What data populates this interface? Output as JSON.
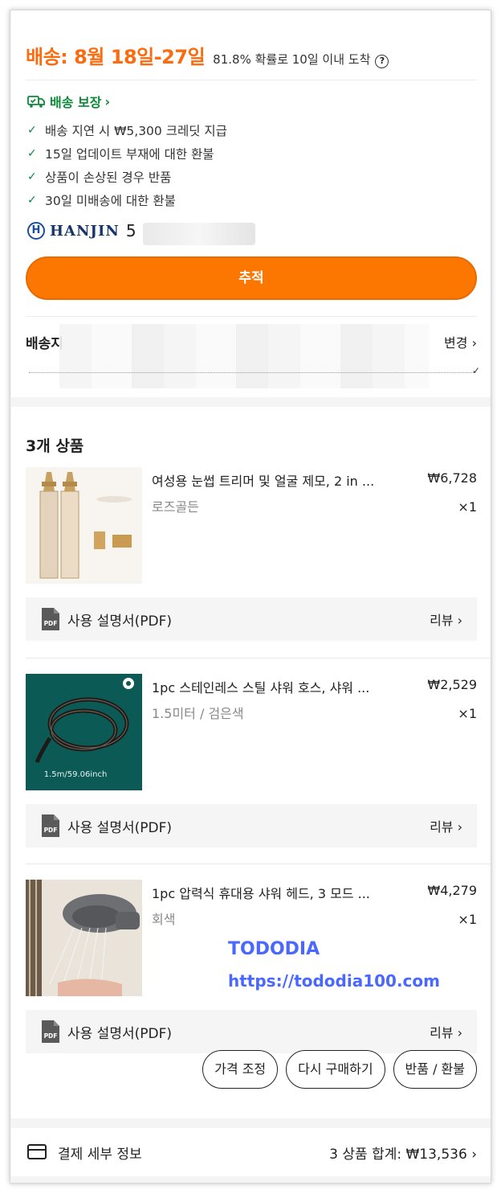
{
  "delivery": {
    "date": "배송: 8월 18일-27일",
    "probability": "81.8% 확률로 10일 이내 도착",
    "help_icon": "question-circle-icon"
  },
  "guarantee": {
    "title": "배송 보장",
    "items": [
      "배송 지연 시 ₩5,300 크레딧 지급",
      "15일 업데이트 부재에 대한 환불",
      "상품이 손상된 경우 반품",
      "30일 미배송에 대한 환불"
    ]
  },
  "carrier": {
    "name": "HANJIN",
    "tracking_visible": "5"
  },
  "track_button": "추적",
  "address": {
    "label": "배송지",
    "change": "변경"
  },
  "items_section": {
    "title": "3개 상품",
    "items": [
      {
        "name": "여성용 눈썹 트리머 및 얼굴 제모, 2 in ...",
        "price": "₩6,728",
        "option": "로즈골든",
        "qty": "×1"
      },
      {
        "name": "1pc 스테인레스 스틸 샤워 호스, 샤워 ...",
        "price": "₩2,529",
        "option": "1.5미터 / 검은색",
        "qty": "×1",
        "thumb_text": "1.5m/59.06inch"
      },
      {
        "name": "1pc 압력식 휴대용 샤워 헤드, 3 모드 ...",
        "price": "₩4,279",
        "option": "회색",
        "qty": "×1"
      }
    ],
    "manual_label": "사용 설명서(PDF)",
    "review_label": "리뷰",
    "pdf_badge": "PDF"
  },
  "actions": {
    "adjust_price": "가격 조정",
    "rebuy": "다시 구매하기",
    "return_refund": "반품 / 환불"
  },
  "watermark": {
    "line1": "TODODIA",
    "line2": "https://tododia100.com"
  },
  "payment": {
    "label": "결제 세부 정보",
    "total": "3 상품 합계: ₩13,536"
  },
  "colors": {
    "accent": "#fb7701",
    "delivery_orange": "#fb6c10",
    "guarantee_green": "#0a8a38",
    "carrier_blue": "#1b4f9c"
  }
}
